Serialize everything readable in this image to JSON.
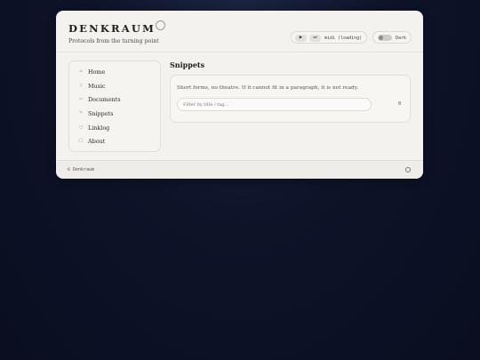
{
  "header": {
    "brand": "DENKRAUM",
    "tagline": "Protocols from the turning point"
  },
  "media": {
    "play_icon": "▶",
    "skip_icon": "⏭",
    "label": "midi (loading)"
  },
  "theme": {
    "label": "Dark",
    "enabled": false
  },
  "sidebar": {
    "items": [
      {
        "icon": "⌂",
        "label": "Home"
      },
      {
        "icon": "♫",
        "label": "Music"
      },
      {
        "icon": "▭",
        "label": "Documents"
      },
      {
        "icon": "✎",
        "label": "Snippets"
      },
      {
        "icon": "□",
        "label": "Linklog"
      },
      {
        "icon": "◯",
        "label": "About"
      }
    ]
  },
  "main": {
    "title": "Snippets",
    "description": "Short forms, no theatre. If it cannot fit in a paragraph, it is not ready.",
    "filter_placeholder": "Filter by title / tag…",
    "count": "0"
  },
  "footer": {
    "copyright": "© Denkraum"
  },
  "colors": {
    "page_background": "#0e1329",
    "window_background": "#f4f2ee"
  }
}
